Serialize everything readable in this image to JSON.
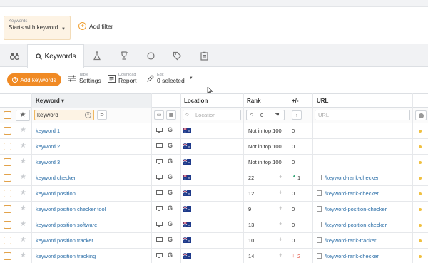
{
  "filter": {
    "small_label": "Keywords",
    "value": "Starts with keyword",
    "add_label": "Add filter"
  },
  "tabs": {
    "active_label": "Keywords"
  },
  "toolbar": {
    "add_label": "Add keywords",
    "table_small": "Table",
    "table_label": "Settings",
    "download_small": "Download",
    "download_label": "Report",
    "edit_small": "Edit",
    "edit_label": "0 selected"
  },
  "headers": {
    "keyword": "Keyword ▾",
    "location": "Location",
    "rank": "Rank",
    "change": "+/-",
    "url": "URL"
  },
  "filters_row": {
    "keyword_value": "keyword",
    "location_placeholder": "Location",
    "rank_value": "0",
    "url_placeholder": "URL"
  },
  "rows": [
    {
      "keyword": "keyword 1",
      "rank": "Not in top 100",
      "change": "0",
      "url": ""
    },
    {
      "keyword": "keyword 2",
      "rank": "Not in top 100",
      "change": "0",
      "url": ""
    },
    {
      "keyword": "keyword 3",
      "rank": "Not in top 100",
      "change": "0",
      "url": ""
    },
    {
      "keyword": "keyword checker",
      "rank": "22",
      "change": "1",
      "url": "/keyword-rank-checker"
    },
    {
      "keyword": "keyword position",
      "rank": "12",
      "change": "0",
      "url": "/keyword-rank-checker"
    },
    {
      "keyword": "keyword position checker tool",
      "rank": "9",
      "change": "0",
      "url": "/keyword-position-checker"
    },
    {
      "keyword": "keyword position software",
      "rank": "13",
      "change": "0",
      "url": "/keyword-position-checker"
    },
    {
      "keyword": "keyword position tracker",
      "rank": "10",
      "change": "0",
      "url": "/keyword-rank-tracker"
    },
    {
      "keyword": "keyword position tracking",
      "rank": "14",
      "change": "2",
      "url": "/keyword-rank-checker"
    }
  ],
  "colors": {
    "accent": "#f08a24",
    "link": "#2c6fa8",
    "up": "#3aa87a",
    "down": "#e04a3a"
  }
}
